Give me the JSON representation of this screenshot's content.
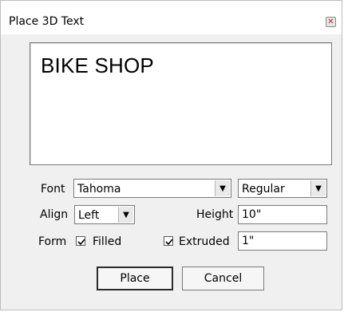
{
  "window": {
    "title": "Place 3D Text",
    "close_icon": "close-icon"
  },
  "text_area": {
    "value": "BIKE SHOP"
  },
  "font": {
    "label": "Font",
    "family": "Tahoma",
    "style": "Regular"
  },
  "align": {
    "label": "Align",
    "value": "Left"
  },
  "height": {
    "label": "Height",
    "value": "10\""
  },
  "form": {
    "label": "Form",
    "filled_label": "Filled",
    "filled_checked": true,
    "extruded_label": "Extruded",
    "extruded_checked": true,
    "extrude_value": "1\""
  },
  "buttons": {
    "place": "Place",
    "cancel": "Cancel"
  },
  "icons": {
    "dropdown": "chevron-down-icon",
    "check": "checkmark-icon"
  }
}
